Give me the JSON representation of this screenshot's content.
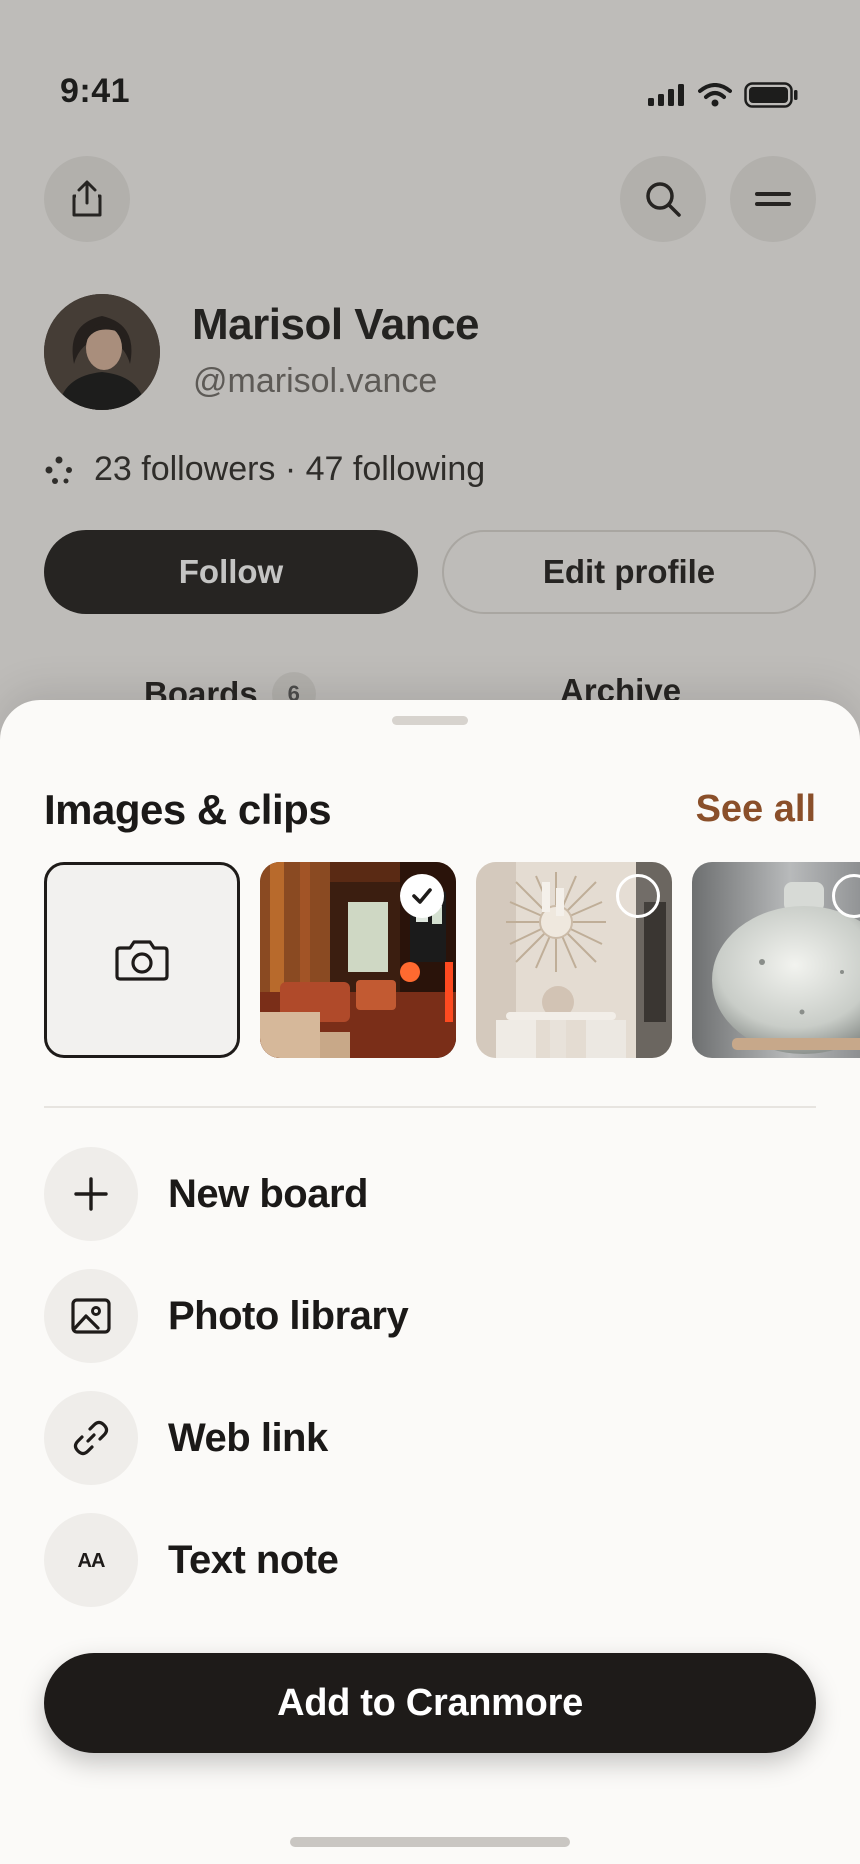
{
  "status_bar": {
    "time": "9:41"
  },
  "profile": {
    "name": "Marisol Vance",
    "handle": "@marisol.vance",
    "followers_text": "23 followers · 47 following",
    "follow_label": "Follow",
    "edit_label": "Edit profile",
    "tabs": [
      {
        "label": "Boards",
        "count": "6"
      },
      {
        "label": "Archive"
      }
    ]
  },
  "sheet": {
    "section_title": "Images & clips",
    "see_all": "See all",
    "thumbnails": [
      {
        "kind": "camera",
        "icon": "camera-icon"
      },
      {
        "kind": "photo",
        "subject": "restaurant interior",
        "selected": true
      },
      {
        "kind": "photo",
        "subject": "dining room with sunburst mirror",
        "selected": false
      },
      {
        "kind": "photo",
        "subject": "white ceramic vase",
        "selected": false
      }
    ],
    "menu": [
      {
        "label": "New board",
        "icon": "plus-icon"
      },
      {
        "label": "Photo library",
        "icon": "image-icon"
      },
      {
        "label": "Web link",
        "icon": "link-icon"
      },
      {
        "label": "Text note",
        "icon": "text-size-icon",
        "icon_text": "AA"
      }
    ],
    "cta_label": "Add to Cranmore"
  },
  "colors": {
    "accent": "#8a4f2a",
    "primary_dark": "#1e1b19",
    "sheet_bg": "#fbfaf8"
  }
}
